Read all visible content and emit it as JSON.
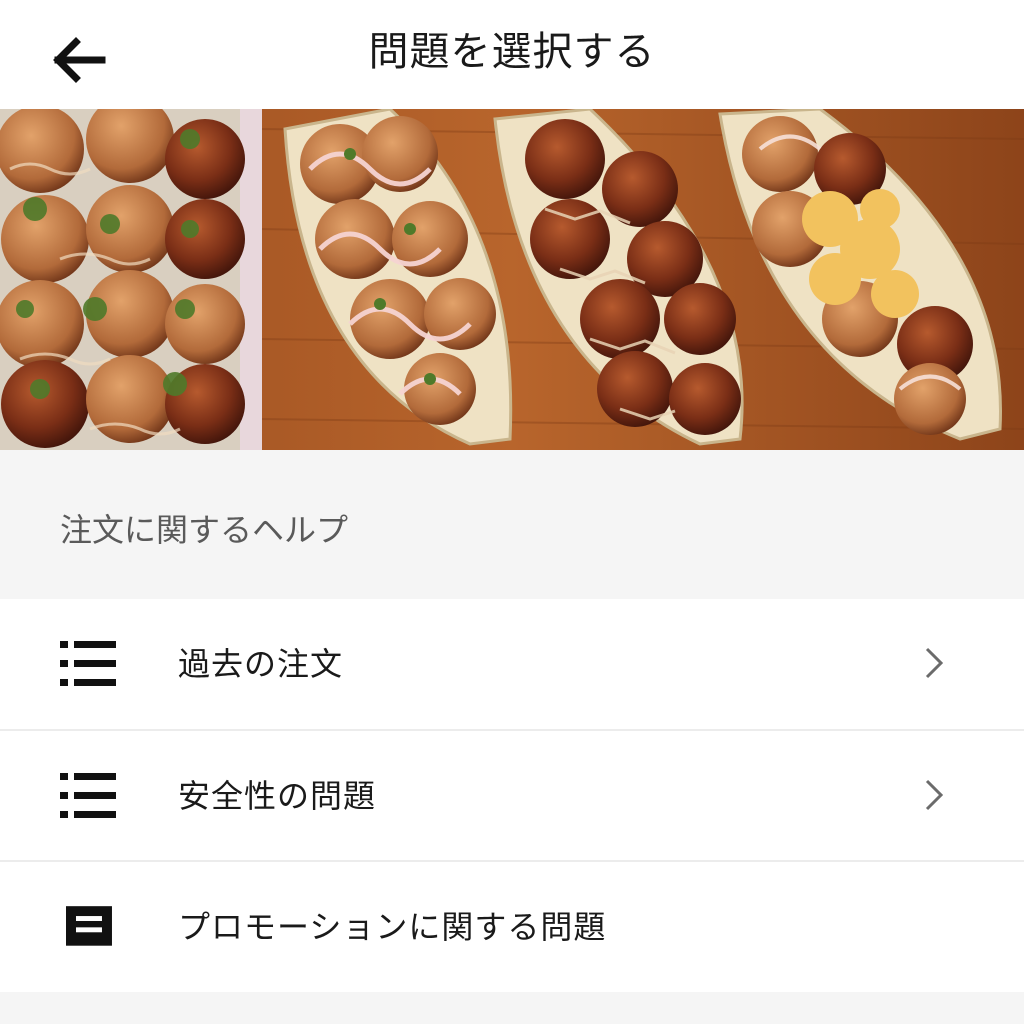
{
  "header": {
    "title": "問題を選択する",
    "back_icon": "arrow-left-icon"
  },
  "hero": {
    "description_icon": "takoyaki-photo"
  },
  "section": {
    "title": "注文に関するヘルプ"
  },
  "menu": {
    "items": [
      {
        "label": "過去の注文",
        "icon": "list-icon",
        "has_chevron": true
      },
      {
        "label": "安全性の問題",
        "icon": "list-icon",
        "has_chevron": true
      },
      {
        "label": "プロモーションに関する問題",
        "icon": "document-icon",
        "has_chevron": false
      }
    ]
  },
  "colors": {
    "background": "#f5f5f5",
    "surface": "#ffffff",
    "text": "#1a1a1a",
    "muted_text": "#5a5a5a",
    "chevron": "#6b6b6b"
  }
}
